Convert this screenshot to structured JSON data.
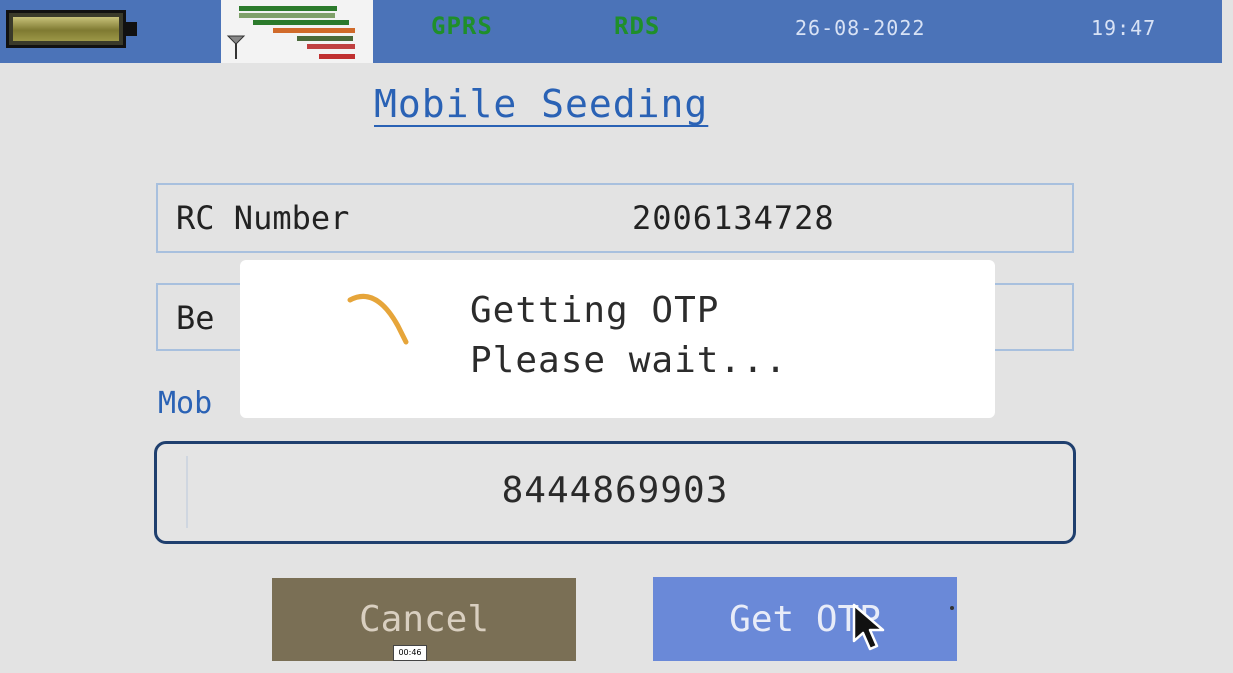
{
  "status_bar": {
    "network_label": "GPRS",
    "service_label": "RDS",
    "date": "26-08-2022",
    "time": "19:47",
    "battery_icon": "battery-icon",
    "signal_icon": "signal-strength-icon"
  },
  "page": {
    "title": "Mobile Seeding"
  },
  "form": {
    "rc_number_label": "RC Number",
    "rc_number_value": "2006134728",
    "beneficiary_label_visible": "Be",
    "mobile_label_visible": "Mob",
    "mobile_value": "8444869903"
  },
  "buttons": {
    "cancel": "Cancel",
    "get_otp": "Get OTP"
  },
  "dialog": {
    "line1": "Getting OTP",
    "line2": "Please wait...",
    "icon": "spinner-icon"
  },
  "overlay": {
    "timestamp": "00:46"
  },
  "colors": {
    "status_bar": "#4b73b8",
    "accent_blue": "#2a62b5",
    "network_green": "#1f8f2a",
    "cancel_button": "#7a6f55",
    "get_otp_button": "#6a89d8"
  }
}
